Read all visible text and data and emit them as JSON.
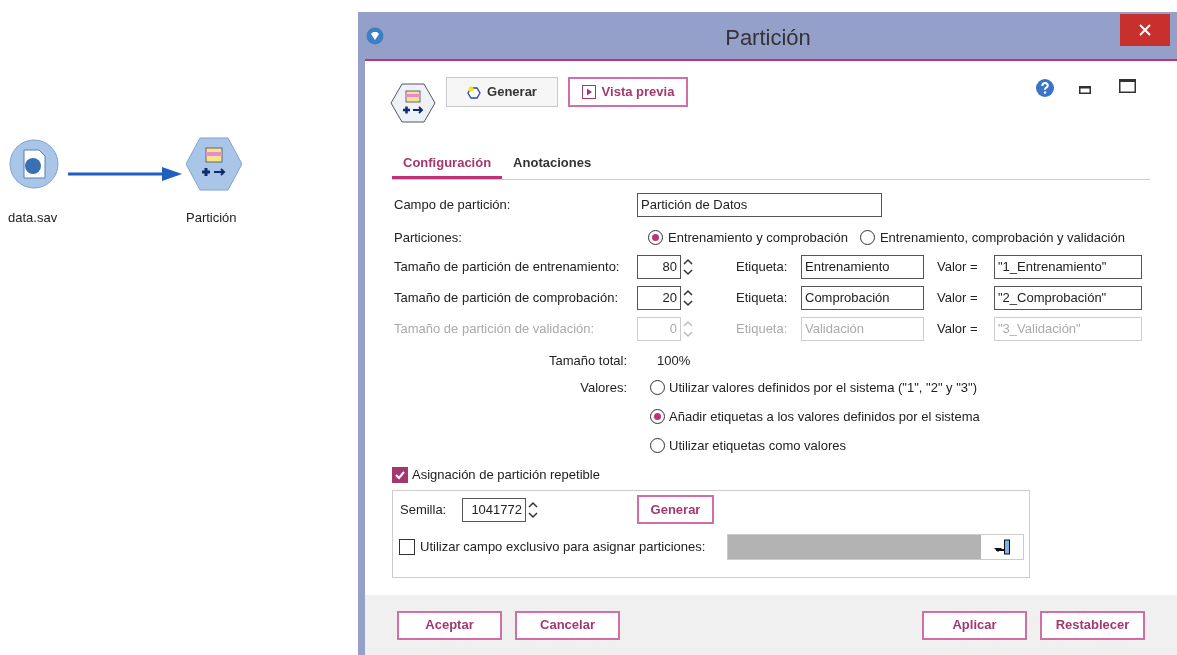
{
  "canvas": {
    "nodes": [
      {
        "label": "data.sav",
        "kind": "source"
      },
      {
        "label": "Partición",
        "kind": "partition"
      }
    ]
  },
  "window": {
    "title": "Partición"
  },
  "toolbar": {
    "buttons": [
      {
        "label": "Generar",
        "kind": "generate"
      },
      {
        "label": "Vista previa",
        "kind": "preview"
      }
    ]
  },
  "tabs": [
    {
      "label": "Configuración",
      "selected": true
    },
    {
      "label": "Anotaciones",
      "selected": false
    }
  ],
  "partition_field": {
    "label": "Campo de partición:",
    "value": "Partición de Datos"
  },
  "partitions": {
    "label": "Particiones:",
    "options": [
      {
        "label": "Entrenamiento y comprobación",
        "selected": true
      },
      {
        "label": "Entrenamiento, comprobación y validación",
        "selected": false
      }
    ]
  },
  "sizes": [
    {
      "label": "Tamaño de partición de entrenamiento:",
      "size": "80",
      "tag_label": "Etiqueta:",
      "tag": "Entrenamiento",
      "value_label": "Valor =",
      "value": "\"1_Entrenamiento\"",
      "disabled": false
    },
    {
      "label": "Tamaño de partición de comprobación:",
      "size": "20",
      "tag_label": "Etiqueta:",
      "tag": "Comprobación",
      "value_label": "Valor =",
      "value": "\"2_Comprobación\"",
      "disabled": false
    },
    {
      "label": "Tamaño de partición de validación:",
      "size": "0",
      "tag_label": "Etiqueta:",
      "tag": "Validación",
      "value_label": "Valor =",
      "value": "\"3_Validación\"",
      "disabled": true
    }
  ],
  "total": {
    "label": "Tamaño total:",
    "value": "100%"
  },
  "values": {
    "label": "Valores:",
    "options": [
      {
        "label": "Utilizar valores definidos por el sistema (\"1\", \"2\" y \"3\")",
        "selected": false
      },
      {
        "label": "Añadir etiquetas a los valores definidos por el sistema",
        "selected": true
      },
      {
        "label": "Utilizar etiquetas como valores",
        "selected": false
      }
    ]
  },
  "repeatable": {
    "label": "Asignación de partición repetible",
    "checked": true
  },
  "seed": {
    "label": "Semilla:",
    "value": "1041772",
    "button": "Generar"
  },
  "exclusive_field": {
    "label": "Utilizar campo exclusivo para asignar particiones:",
    "checked": false
  },
  "footer": {
    "left": [
      "Aceptar",
      "Cancelar"
    ],
    "right": [
      "Aplicar",
      "Restablecer"
    ]
  }
}
